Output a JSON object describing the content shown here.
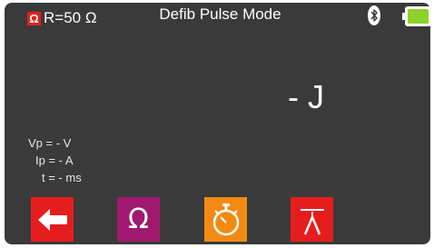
{
  "header": {
    "ohm_badge": "Ω",
    "resistance": "R=50 Ω",
    "title": "Defib Pulse Mode",
    "icons": [
      "bluetooth-icon",
      "battery-icon"
    ]
  },
  "readout": {
    "energy": "- J"
  },
  "measurements": {
    "vp": "Vp = - V",
    "ip": "Ip = - A",
    "t": "t = - ms"
  },
  "softkeys": [
    {
      "icon": "back-arrow-icon",
      "color": "#e51d1d"
    },
    {
      "icon": "ohm-icon",
      "label": "Ω",
      "color": "#a0196e"
    },
    {
      "icon": "timer-icon",
      "color": "#f28a13"
    },
    {
      "icon": "pulse-icon",
      "color": "#e51d1d"
    }
  ],
  "colors": {
    "background": "#3a3a3a",
    "battery": "#8ed12a",
    "accent_red": "#e51d1d"
  }
}
